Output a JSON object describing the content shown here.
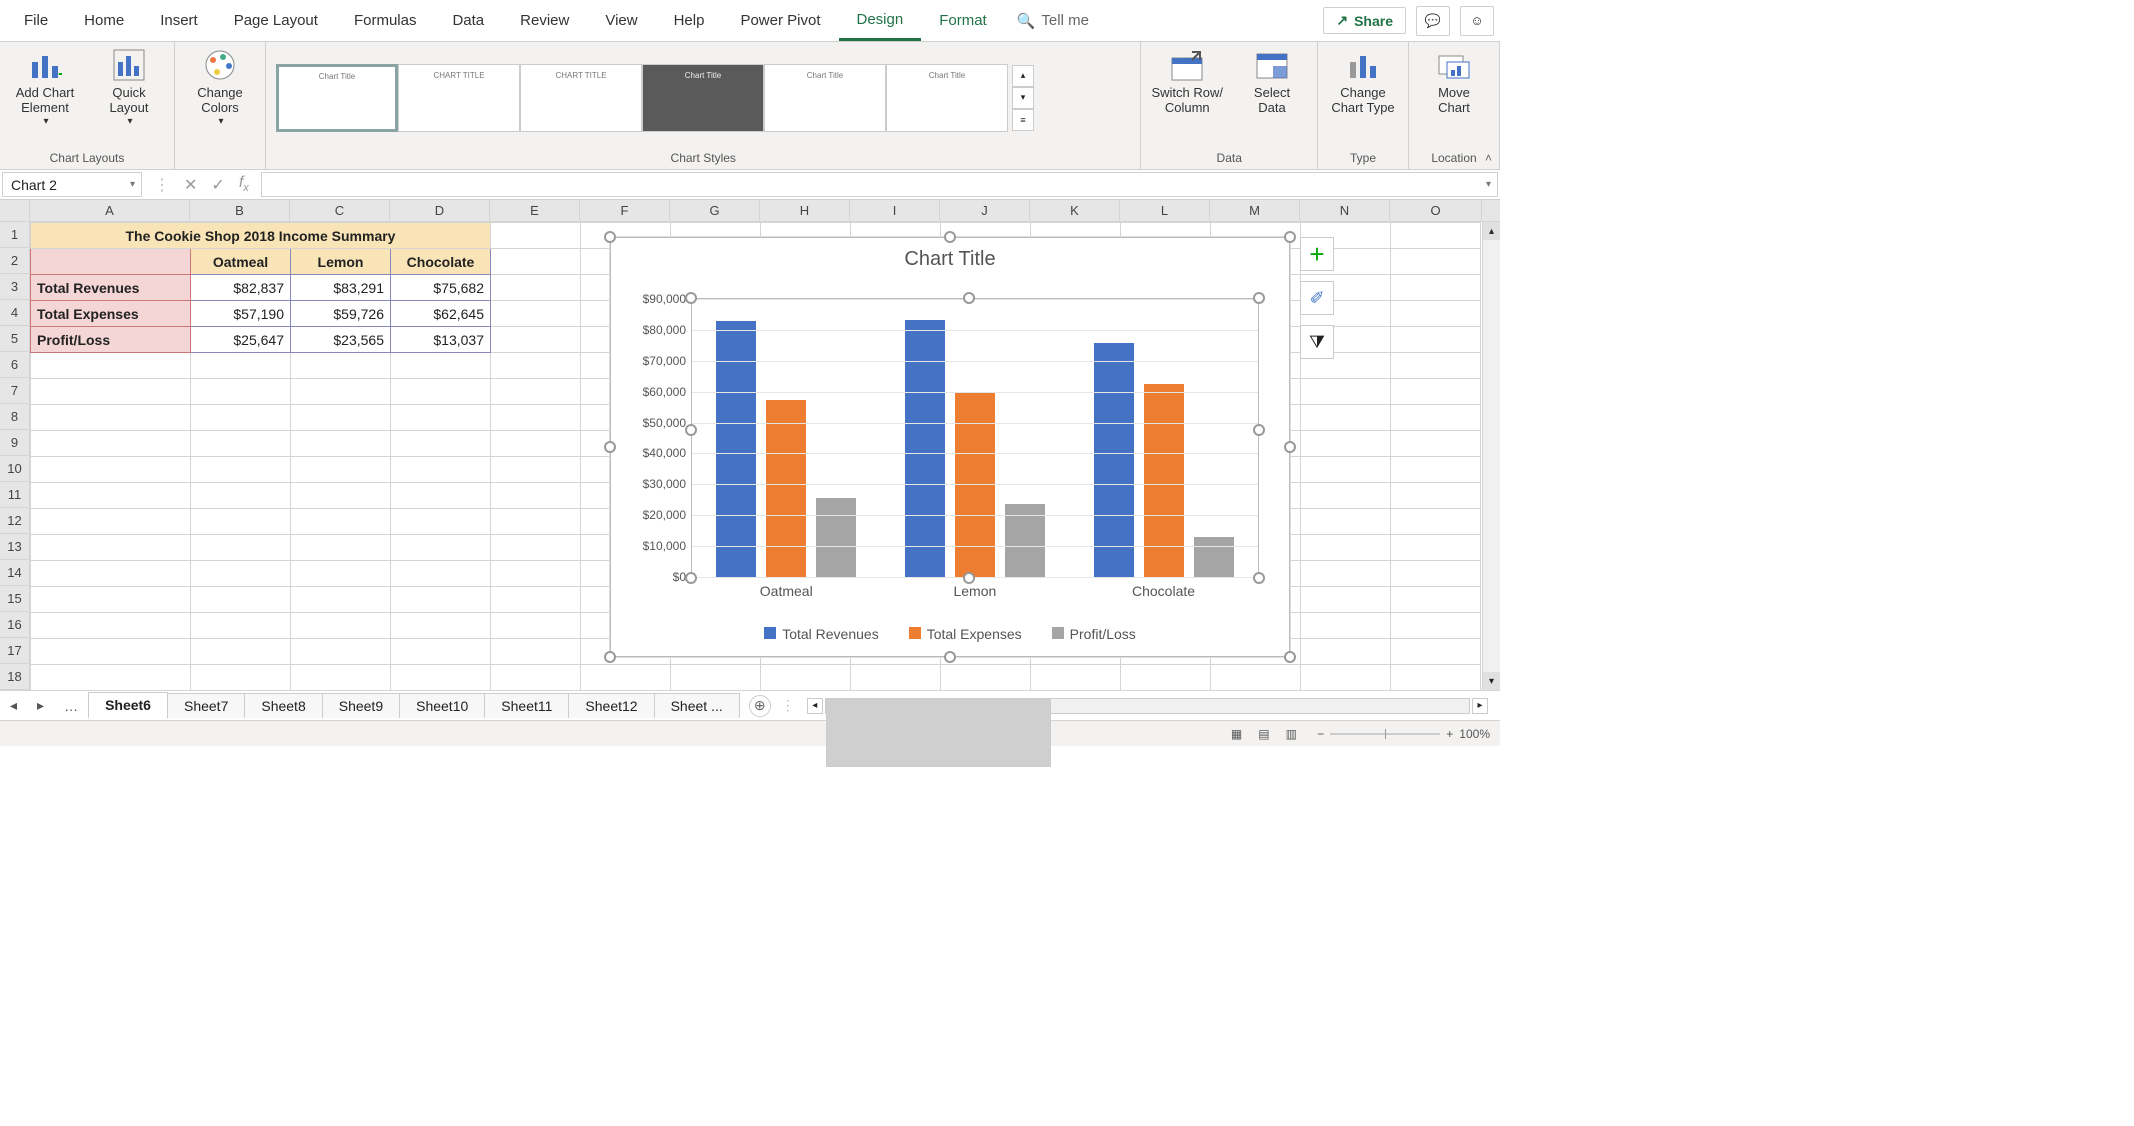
{
  "tabs": {
    "file": "File",
    "home": "Home",
    "insert": "Insert",
    "page_layout": "Page Layout",
    "formulas": "Formulas",
    "data": "Data",
    "review": "Review",
    "view": "View",
    "help": "Help",
    "power_pivot": "Power Pivot",
    "design": "Design",
    "format": "Format",
    "tell_me": "Tell me",
    "share": "Share"
  },
  "ribbon": {
    "groups": {
      "chart_layouts": "Chart Layouts",
      "chart_styles": "Chart Styles",
      "data": "Data",
      "type": "Type",
      "location": "Location"
    },
    "add_chart_element": "Add Chart\nElement",
    "quick_layout": "Quick\nLayout",
    "change_colors": "Change\nColors",
    "switch_rc": "Switch Row/\nColumn",
    "select_data": "Select\nData",
    "change_chart_type": "Change\nChart Type",
    "move_chart": "Move\nChart"
  },
  "namebox": "Chart 2",
  "columns": [
    "A",
    "B",
    "C",
    "D",
    "E",
    "F",
    "G",
    "H",
    "I",
    "J",
    "K",
    "L",
    "M",
    "N",
    "O"
  ],
  "rows": [
    "1",
    "2",
    "3",
    "4",
    "5",
    "6",
    "7",
    "8",
    "9",
    "10",
    "11",
    "12",
    "13",
    "14",
    "15",
    "16",
    "17",
    "18"
  ],
  "sheet": {
    "title": "The Cookie Shop 2018 Income Summary",
    "col_heads": [
      "Oatmeal",
      "Lemon",
      "Chocolate"
    ],
    "row_heads": [
      "Total Revenues",
      "Total Expenses",
      "Profit/Loss"
    ],
    "vals": [
      [
        "$82,837",
        "$83,291",
        "$75,682"
      ],
      [
        "$57,190",
        "$59,726",
        "$62,645"
      ],
      [
        "$25,647",
        "$23,565",
        "$13,037"
      ]
    ]
  },
  "chart_data": {
    "type": "bar",
    "title": "Chart Title",
    "categories": [
      "Oatmeal",
      "Lemon",
      "Chocolate"
    ],
    "series": [
      {
        "name": "Total Revenues",
        "values": [
          82837,
          83291,
          75682
        ],
        "color": "#4472c4"
      },
      {
        "name": "Total Expenses",
        "values": [
          57190,
          59726,
          62645
        ],
        "color": "#ed7d31"
      },
      {
        "name": "Profit/Loss",
        "values": [
          25647,
          23565,
          13037
        ],
        "color": "#a5a5a5"
      }
    ],
    "ylim": [
      0,
      90000
    ],
    "ystep": 10000,
    "yticks": [
      "$0",
      "$10,000",
      "$20,000",
      "$30,000",
      "$40,000",
      "$50,000",
      "$60,000",
      "$70,000",
      "$80,000",
      "$90,000"
    ]
  },
  "sheets": [
    "Sheet6",
    "Sheet7",
    "Sheet8",
    "Sheet9",
    "Sheet10",
    "Sheet11",
    "Sheet12",
    "Sheet ..."
  ],
  "active_sheet": "Sheet6",
  "zoom": "100%"
}
